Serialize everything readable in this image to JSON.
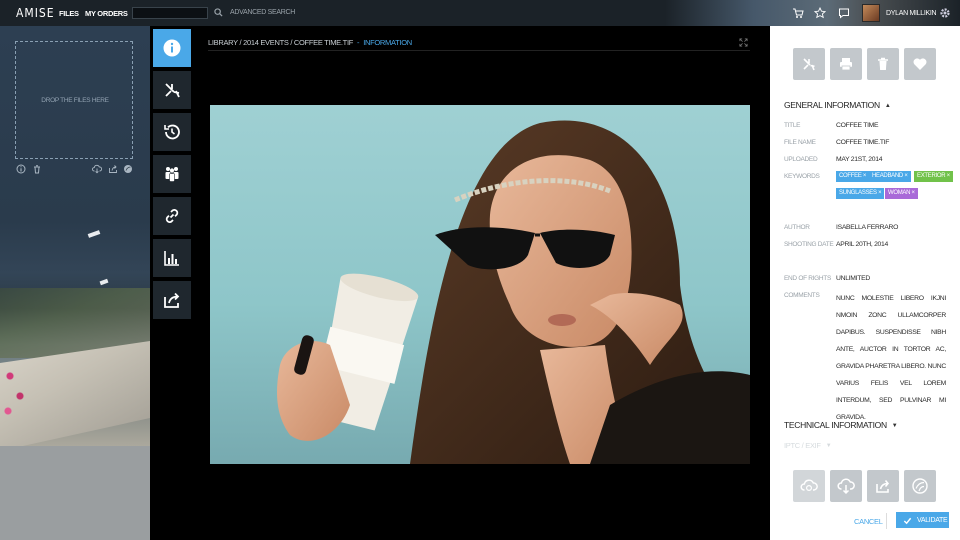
{
  "topbar": {
    "logo": "AMISE",
    "nav": [
      "FILES",
      "MY ORDERS"
    ],
    "search_placeholder": "",
    "advanced_search": "ADVANCED SEARCH",
    "username": "DYLAN MILLIKIN",
    "icons": [
      "cart-icon",
      "star-icon",
      "chat-icon",
      "settings-gear-icon"
    ]
  },
  "left_panel": {
    "drop_text": "DROP THE FILES HERE",
    "drop_icons": [
      "info-icon",
      "trash-icon",
      "cloud-download-icon",
      "share-icon",
      "disc-icon"
    ]
  },
  "tools": [
    "info-icon",
    "crop-tools-icon",
    "history-icon",
    "people-icon",
    "link-icon",
    "stats-icon",
    "share-icon"
  ],
  "center": {
    "breadcrumb": "LIBRARY / 2014 EVENTS / COFFEE TIME.TIF",
    "breadcrumb_sep": "-",
    "breadcrumb_active": "INFORMATION"
  },
  "right_panel": {
    "top_buttons": [
      "crop-icon",
      "print-icon",
      "trash-icon",
      "heart-icon"
    ],
    "general_title": "GENERAL INFORMATION",
    "fields": {
      "title_label": "TITLE",
      "title_value": "COFFEE TIME",
      "filename_label": "FILE NAME",
      "filename_value": "COFFEE TIME.TIF",
      "uploaded_label": "UPLOADED",
      "uploaded_value": "MAY 21ST, 2014",
      "keywords_label": "KEYWORDS",
      "author_label": "AUTHOR",
      "author_value": "ISABELLA FERRARO",
      "shooting_label": "SHOOTING DATE",
      "shooting_value": "APRIL 20TH, 2014",
      "rights_label": "END OF RIGHTS",
      "rights_value": "UNLIMITED",
      "comments_label": "COMMENTS",
      "comments_value": "NUNC MOLESTIE LIBERO IKJNI NMOIN ZONC ULLAMCORPER DAPIBUS. SUSPENDISSE NIBH ANTE, AUCTOR IN TORTOR AC, GRAVIDA PHARETRA LIBERO. NUNC VARIUS FELIS VEL LOREM INTERDUM, SED PULVINAR MI GRAVIDA."
    },
    "keywords": [
      {
        "text": "COFFEE",
        "color": "#4aa8e8"
      },
      {
        "text": "HEADBAND",
        "color": "#4aa8e8"
      },
      {
        "text": "EXTERIOR",
        "color": "#71c24a"
      },
      {
        "text": "SUNGLASSES",
        "color": "#4aa8e8"
      },
      {
        "text": "WOMAN",
        "color": "#a96ad8"
      }
    ],
    "tech_title": "TECHNICAL INFORMATION",
    "iptc_title": "IPTC / EXIF",
    "bottom_buttons": [
      "cloud-upload-icon",
      "cloud-download-icon",
      "share-icon",
      "disc-icon"
    ],
    "cancel": "CANCEL",
    "validate": "VALIDATE"
  }
}
